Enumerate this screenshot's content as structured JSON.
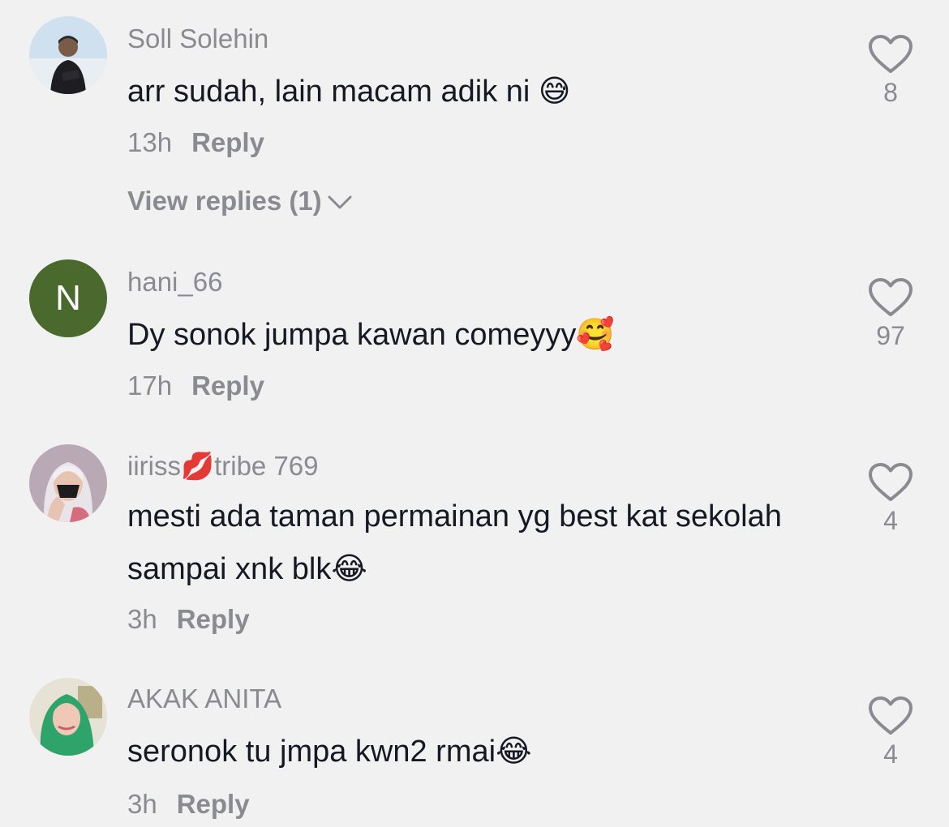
{
  "comments": [
    {
      "username": "Soll Solehin",
      "text": "arr sudah, lain macam adik ni ",
      "emoji": "😅",
      "time": "13h",
      "reply_label": "Reply",
      "likes": "8",
      "view_replies": "View replies (1)"
    },
    {
      "username": "hani_66",
      "avatar_letter": "N",
      "text": "Dy sonok jumpa kawan comeyyy",
      "emoji": "🥰",
      "time": "17h",
      "reply_label": "Reply",
      "likes": "97"
    },
    {
      "username_part1": "iiriss",
      "username_emoji": "💋",
      "username_part2": "tribe 769",
      "text": "mesti ada taman permainan yg best kat sekolah sampai xnk blk",
      "emoji": "😂",
      "time": "3h",
      "reply_label": "Reply",
      "likes": "4"
    },
    {
      "username": "AKAK ANITA",
      "text": "seronok tu jmpa kwn2 rmai",
      "emoji": "😂",
      "time": "3h",
      "reply_label": "Reply",
      "likes": "4"
    }
  ],
  "icons": {
    "like": "heart-outline-icon",
    "expand": "chevron-down-icon"
  },
  "colors": {
    "background": "#f1f1f2",
    "secondary_text": "#8a8b91",
    "primary_text": "#161823",
    "avatar_green": "#4a6a2d"
  }
}
